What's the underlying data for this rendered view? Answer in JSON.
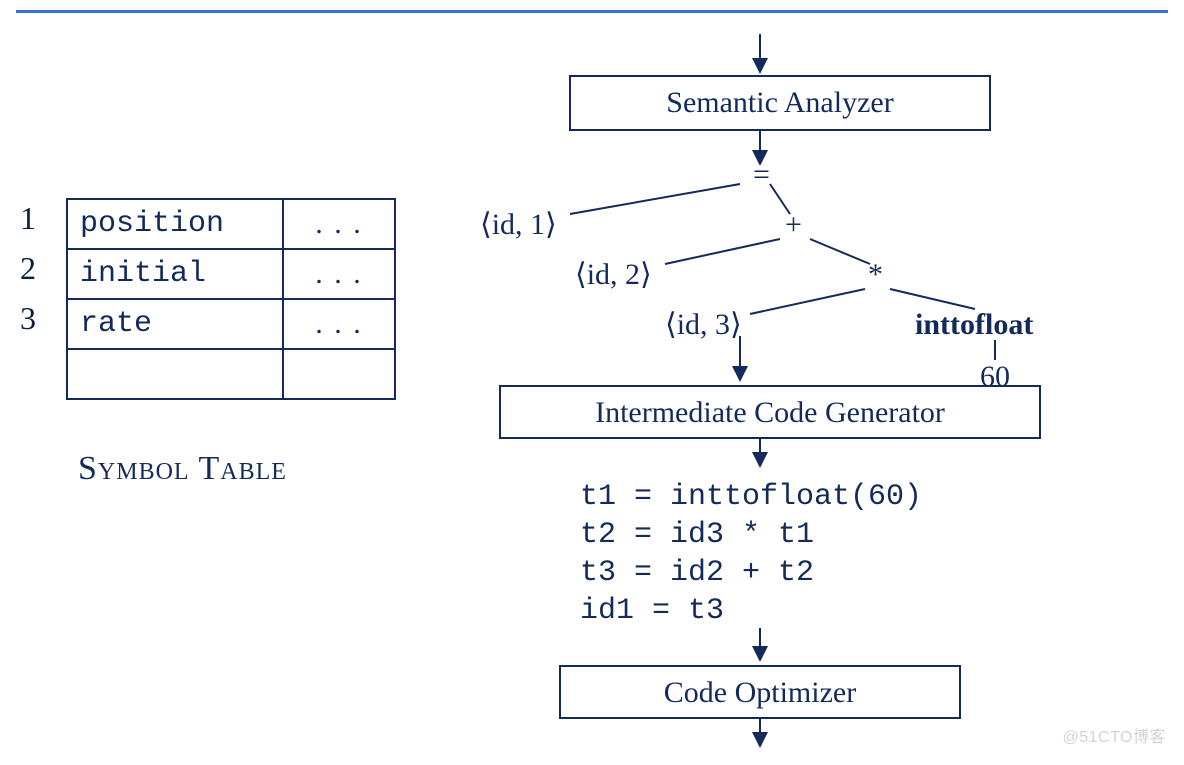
{
  "symbol_table": {
    "rows": [
      {
        "idx": "1",
        "name": "position",
        "info": ". . ."
      },
      {
        "idx": "2",
        "name": "initial",
        "info": ". . ."
      },
      {
        "idx": "3",
        "name": "rate",
        "info": ". . ."
      },
      {
        "idx": "",
        "name": "",
        "info": ""
      }
    ],
    "caption": "Symbol Table"
  },
  "stages": {
    "semantic": "Semantic Analyzer",
    "intermediate": "Intermediate Code Generator",
    "optimizer": "Code Optimizer"
  },
  "tree": {
    "eq": "=",
    "id1": "⟨id, 1⟩",
    "plus": "+",
    "id2": "⟨id, 2⟩",
    "star": "*",
    "id3": "⟨id, 3⟩",
    "inttofloat": "inttofloat",
    "sixty": "60"
  },
  "tac": {
    "l1": "t1 = inttofloat(60)",
    "l2": "t2 = id3 * t1",
    "l3": "t3 = id2 + t2",
    "l4": "id1 = t3"
  },
  "watermark": "@51CTO博客"
}
